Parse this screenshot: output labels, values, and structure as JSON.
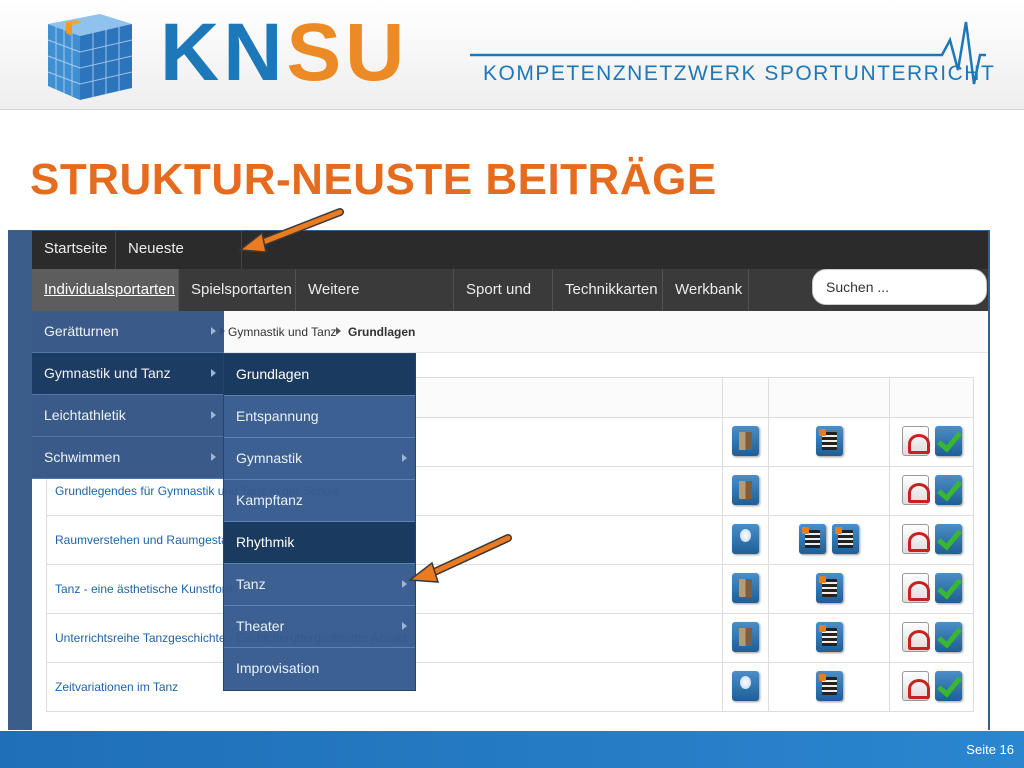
{
  "logo": {
    "letters_blue": "KN",
    "letters_orange": "SU",
    "tagline": "KOMPETENZNETZWERK SPORTUNTERRICHT"
  },
  "slide_title": "STRUKTUR-NEUSTE BEITRÄGE",
  "top_nav": [
    "Startseite",
    "Neueste Beiträge"
  ],
  "main_nav": [
    "Individualsportarten",
    "Spielsportarten",
    "Weitere Sportbereiche",
    "Sport und ...",
    "Technikkarten",
    "Werkbank"
  ],
  "search": {
    "placeholder": "Suchen ..."
  },
  "breadcrumb": [
    "Gymnastik und Tanz",
    "Grundlagen"
  ],
  "menu_level1": [
    "Gerätturnen",
    "Gymnastik und Tanz",
    "Leichtathletik",
    "Schwimmen"
  ],
  "menu_level2": [
    "Grundlagen",
    "Entspannung",
    "Gymnastik",
    "Kampftanz",
    "Rhythmik",
    "Tanz",
    "Theater",
    "Improvisation"
  ],
  "table_rows": [
    "Grundlegendes für Gymnastik und Tanz in der Schule",
    "Raumverstehen und Raumgestaltung",
    "Tanz - eine ästhetische Kunstform",
    "Unterrichtsreihe Tanzgeschichte - Ein fächerübergreifender Ansatz",
    "Zeitvariationen im Tanz"
  ],
  "footer": {
    "page": "Seite 16"
  },
  "colors": {
    "blue": "#1c78b8",
    "orange": "#ec8a25",
    "title": "#e56c1e"
  }
}
